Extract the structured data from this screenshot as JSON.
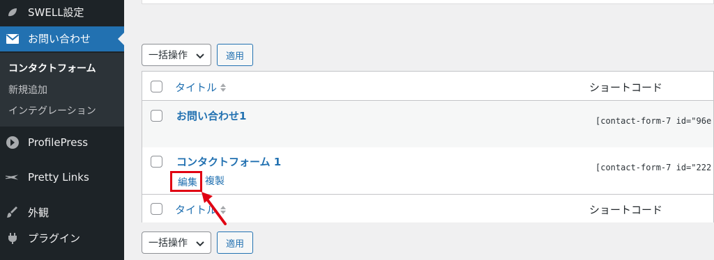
{
  "sidebar": {
    "items": [
      {
        "label": "SWELL設定",
        "icon": "swell-leaf-icon"
      },
      {
        "label": "お問い合わせ",
        "icon": "envelope-icon",
        "active": true
      },
      {
        "label": "ProfilePress",
        "icon": "profilepress-icon"
      },
      {
        "label": "Pretty Links",
        "icon": "star-link-icon"
      },
      {
        "label": "外観",
        "icon": "paintbrush-icon"
      },
      {
        "label": "プラグイン",
        "icon": "plugin-icon"
      }
    ],
    "submenu": [
      {
        "label": "コンタクトフォーム",
        "current": true
      },
      {
        "label": "新規追加"
      },
      {
        "label": "インテグレーション"
      }
    ]
  },
  "bulk": {
    "select_label": "一括操作",
    "apply_label": "適用"
  },
  "table": {
    "columns": {
      "title": "タイトル",
      "shortcode": "ショートコード"
    },
    "rows": [
      {
        "title": "お問い合わせ1",
        "shortcode": "[contact-form-7 id=\"96e"
      },
      {
        "title": "コンタクトフォーム 1",
        "shortcode": "[contact-form-7 id=\"222"
      }
    ],
    "row_actions": {
      "edit": "編集",
      "duplicate": "複製"
    }
  },
  "colors": {
    "sidebar_bg": "#1d2327",
    "active_bg": "#2271b1",
    "link": "#2271b1",
    "highlight": "#e00012"
  }
}
